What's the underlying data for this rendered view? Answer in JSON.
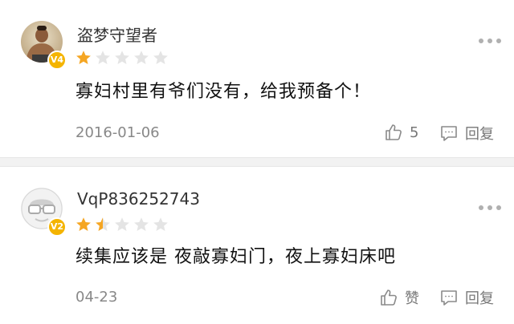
{
  "comments": [
    {
      "username": "盗梦守望者",
      "level_badge": "V4",
      "rating": 1,
      "rating_max": 5,
      "text": "寡妇村里有爷们没有，给我预备个！",
      "date": "2016-01-06",
      "like_label": "5",
      "reply_label": "回复"
    },
    {
      "username": "VqP836252743",
      "level_badge": "V2",
      "rating": 1.5,
      "rating_max": 5,
      "text": "续集应该是 夜敲寡妇门，夜上寡妇床吧",
      "date": "04-23",
      "like_label": "赞",
      "reply_label": "回复"
    }
  ],
  "colors": {
    "star_filled": "#f5a623",
    "star_empty": "#e4e4e4",
    "badge": "#f4b400",
    "meta_text": "#888888"
  },
  "icons": {
    "like": "thumbs-up-icon",
    "reply": "comment-bubble-icon",
    "more": "more-dots-icon"
  }
}
